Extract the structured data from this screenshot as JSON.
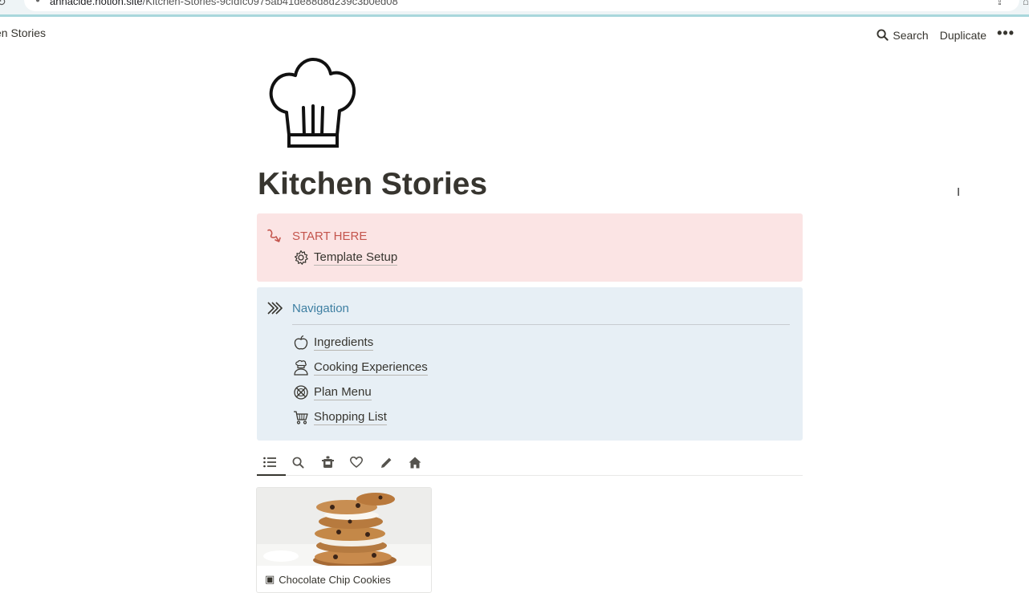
{
  "browser": {
    "url_host": "annacide.notion.site",
    "url_path": "/Kitchen-Stories-9cfdfc0975ab41de88d8d239c3b0ed08"
  },
  "topbar": {
    "breadcrumb": "en Stories",
    "search_label": "Search",
    "duplicate_label": "Duplicate",
    "more_label": "•••"
  },
  "page": {
    "icon": "chef-hat-icon",
    "title": "Kitchen Stories"
  },
  "start_callout": {
    "icon": "curved-arrow-icon",
    "heading": "START HERE",
    "link": {
      "icon": "gear-icon",
      "label": "Template Setup"
    }
  },
  "nav_callout": {
    "icon": "double-chevron-icon",
    "heading": "Navigation",
    "links": [
      {
        "icon": "apple-icon",
        "label": "Ingredients"
      },
      {
        "icon": "chef-icon",
        "label": "Cooking Experiences"
      },
      {
        "icon": "plate-icon",
        "label": "Plan Menu"
      },
      {
        "icon": "cart-icon",
        "label": "Shopping List"
      }
    ]
  },
  "tabs": {
    "items": [
      "list-icon",
      "search-icon",
      "pot-icon",
      "heart-icon",
      "pencil-icon",
      "home-icon"
    ],
    "active": 0
  },
  "gallery": {
    "cards": [
      {
        "title": "Chocolate Chip Cookies",
        "cover": "cookies-photo"
      }
    ]
  },
  "colors": {
    "start_bg": "#fbe4e4",
    "start_text": "#c4554d",
    "nav_bg": "#e7eff5",
    "nav_text": "#3e7fa2"
  }
}
